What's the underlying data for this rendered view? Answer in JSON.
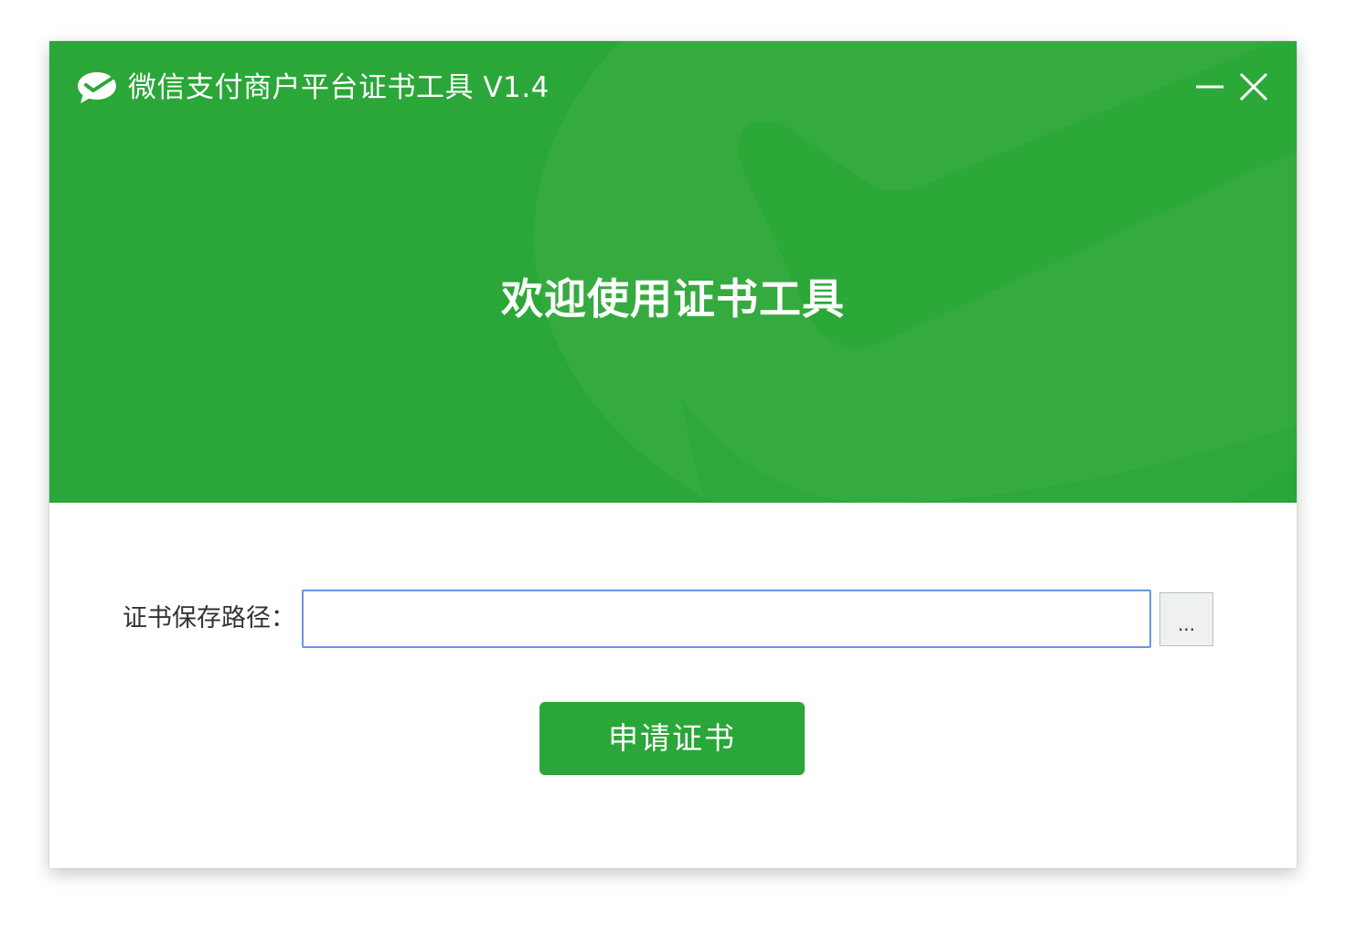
{
  "window": {
    "title": "微信支付商户平台证书工具 V1.4",
    "minimize_icon": "minimize-icon",
    "close_icon": "close-icon",
    "logo_icon": "wechat-pay-logo-icon"
  },
  "header": {
    "welcome_text": "欢迎使用证书工具"
  },
  "form": {
    "path_label": "证书保存路径：",
    "path_value": "",
    "browse_label": "...",
    "apply_label": "申请证书"
  },
  "colors": {
    "brand_green": "#2aa738",
    "input_border": "#6b95e3"
  }
}
